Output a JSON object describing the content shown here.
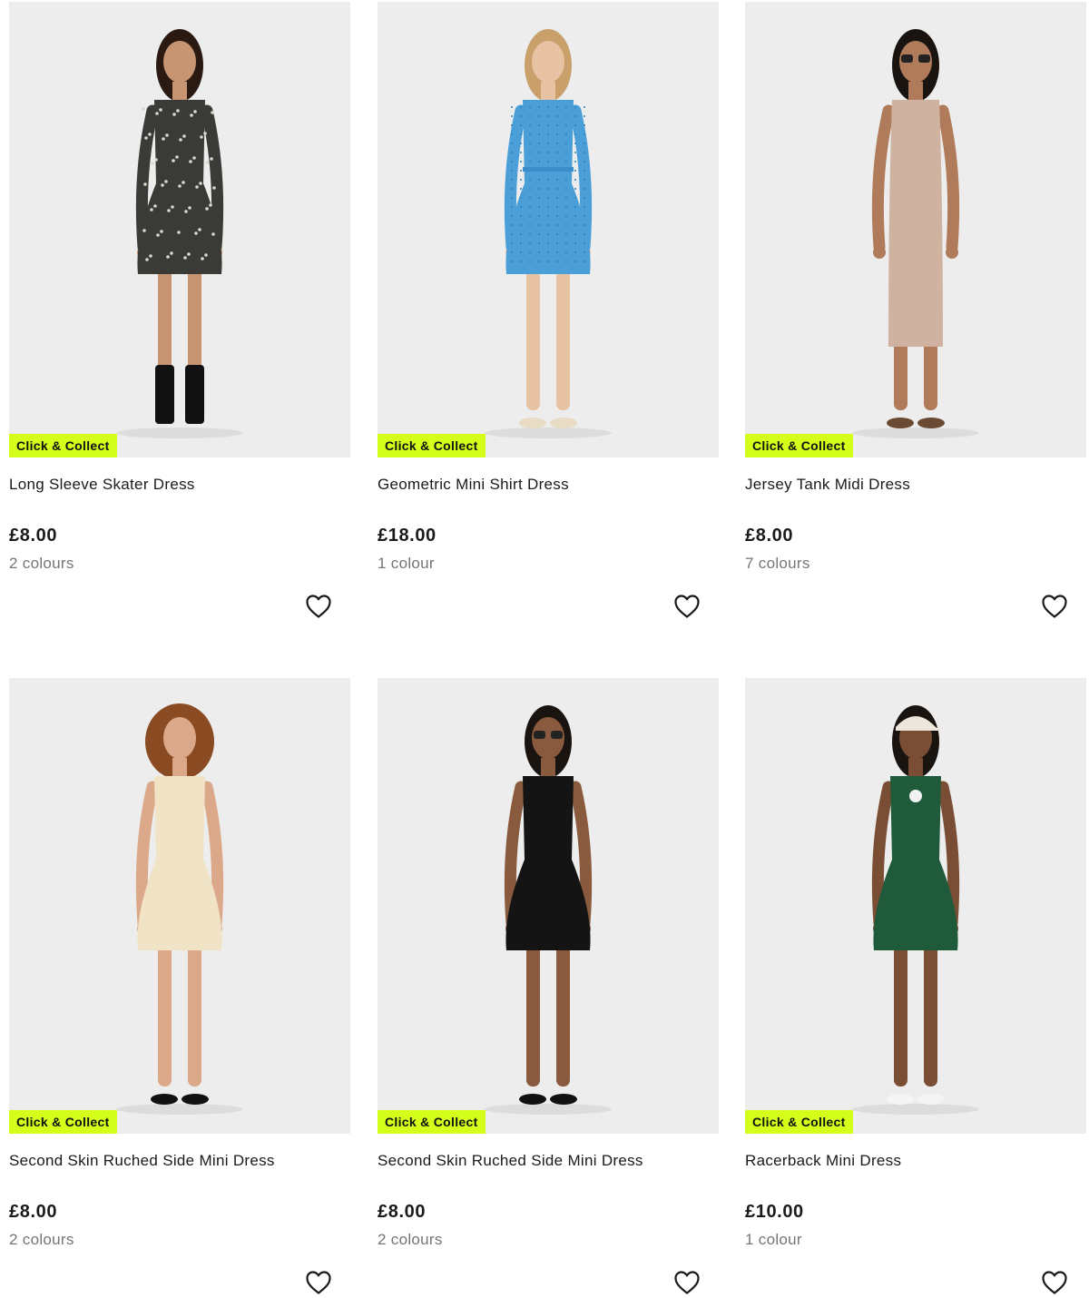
{
  "products": [
    {
      "name": "Long Sleeve Skater Dress",
      "price": "£8.00",
      "colours": "2 colours",
      "badge": "Click & Collect",
      "dress_color": "#3a3a36",
      "pattern": "leopard",
      "shoe_color": "#111111"
    },
    {
      "name": "Geometric Mini Shirt Dress",
      "price": "£18.00",
      "colours": "1 colour",
      "badge": "Click & Collect",
      "dress_color": "#4a9fd8",
      "pattern": "dots",
      "shoe_color": "#e9dcc4"
    },
    {
      "name": "Jersey Tank Midi Dress",
      "price": "£8.00",
      "colours": "7 colours",
      "badge": "Click & Collect",
      "dress_color": "#cfb3a0",
      "pattern": "plain",
      "shoe_color": "#6b4a33"
    },
    {
      "name": "Second Skin Ruched Side Mini Dress",
      "price": "£8.00",
      "colours": "2 colours",
      "badge": "Click & Collect",
      "dress_color": "#f1e3c6",
      "pattern": "plain",
      "shoe_color": "#111111"
    },
    {
      "name": "Second Skin Ruched Side Mini Dress",
      "price": "£8.00",
      "colours": "2 colours",
      "badge": "Click & Collect",
      "dress_color": "#141414",
      "pattern": "plain",
      "shoe_color": "#111111"
    },
    {
      "name": "Racerback Mini Dress",
      "price": "£10.00",
      "colours": "1 colour",
      "badge": "Click & Collect",
      "dress_color": "#1f5a3a",
      "pattern": "plain",
      "shoe_color": "#f4f4f4"
    }
  ],
  "colors": {
    "badge_bg": "#d4ff1a",
    "image_bg": "#eeeeee",
    "muted_text": "#757575"
  }
}
